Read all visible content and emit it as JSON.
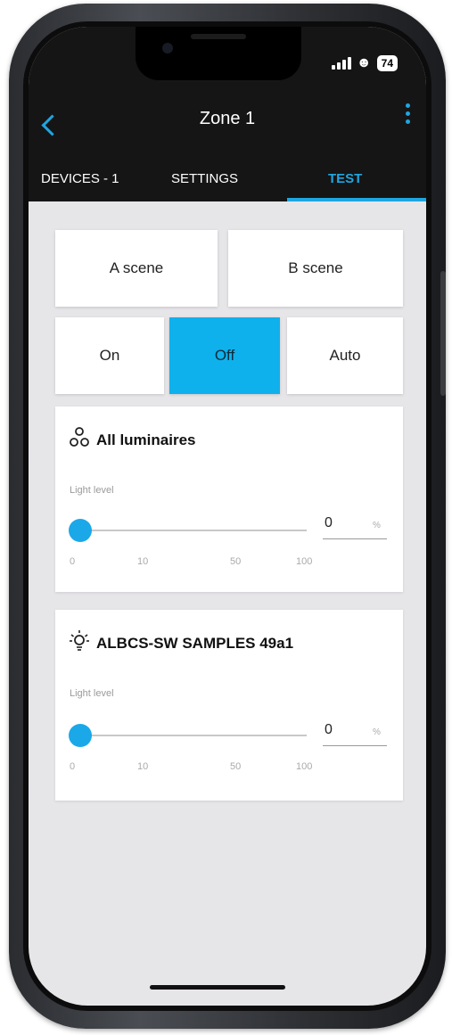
{
  "status_bar": {
    "battery": "74"
  },
  "header": {
    "title": "Zone 1"
  },
  "tabs": [
    {
      "label": "DEVICES - 1",
      "active": false
    },
    {
      "label": "SETTINGS",
      "active": false
    },
    {
      "label": "TEST",
      "active": true
    }
  ],
  "scenes": {
    "a": "A scene",
    "b": "B scene"
  },
  "modes": {
    "on": "On",
    "off": "Off",
    "auto": "Auto",
    "selected": "Off"
  },
  "cards": [
    {
      "title": "All luminaires",
      "icon": "group-luminaires-icon",
      "light_label": "Light level",
      "value": "0",
      "unit": "%",
      "level": 0,
      "ticks": [
        "0",
        "10",
        "50",
        "100"
      ]
    },
    {
      "title": "ALBCS-SW SAMPLES 49a1",
      "icon": "light-bulb-icon",
      "light_label": "Light level",
      "value": "0",
      "unit": "%",
      "level": 0,
      "ticks": [
        "0",
        "10",
        "50",
        "100"
      ]
    }
  ],
  "colors": {
    "accent": "#1fa6e0",
    "appbar": "#151515",
    "active_button": "#0fb1ec"
  }
}
